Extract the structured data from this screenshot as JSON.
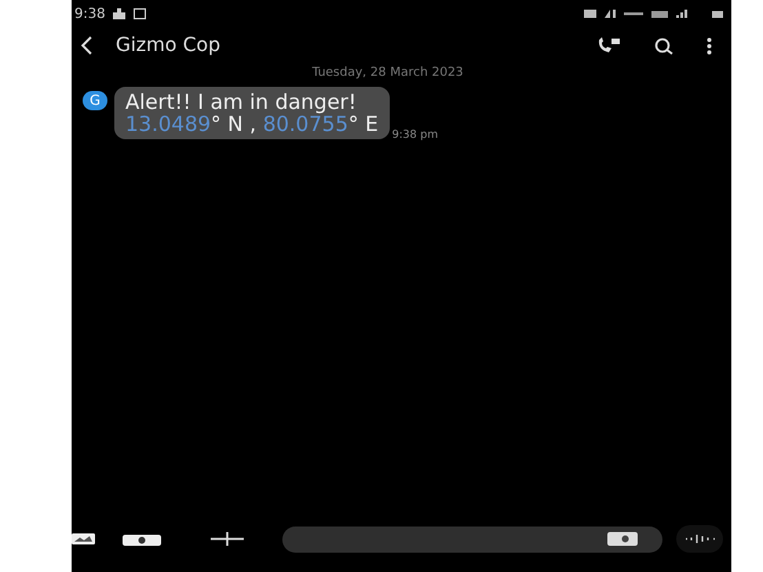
{
  "status_bar": {
    "time": "9:38"
  },
  "header": {
    "title": "Gizmo Cop"
  },
  "date": "Tuesday, 28 March 2023",
  "message": {
    "avatar": "G",
    "text": "Alert!! I am in danger!",
    "location": [
      {
        "text": "13.0489",
        "link": true
      },
      {
        "text": "° N , ",
        "link": false
      },
      {
        "text": "80.0755",
        "link": true
      },
      {
        "text": "° E",
        "link": false
      }
    ],
    "time": "9:38 pm"
  }
}
